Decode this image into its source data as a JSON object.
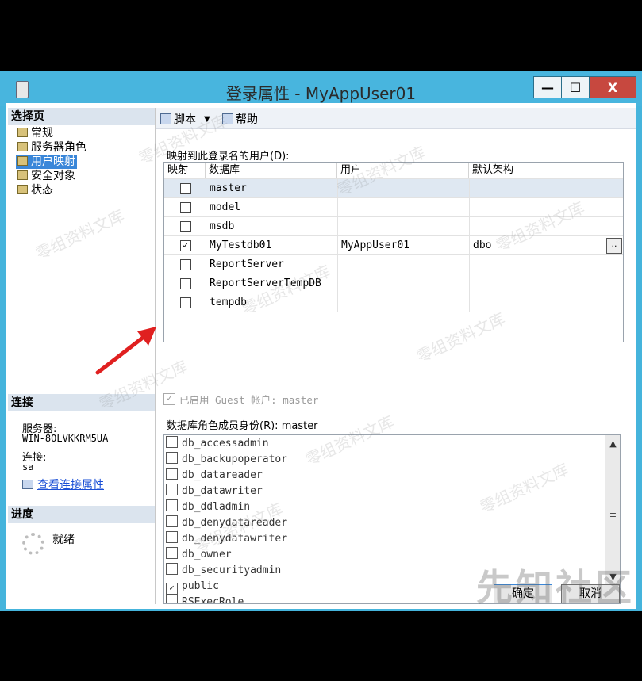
{
  "window": {
    "title": "登录属性 - MyAppUser01",
    "controls": {
      "minimize": "—",
      "maximize": "☐",
      "close": "X"
    }
  },
  "left": {
    "select_page_header": "选择页",
    "pages": [
      {
        "label": "常规",
        "selected": false
      },
      {
        "label": "服务器角色",
        "selected": false
      },
      {
        "label": "用户映射",
        "selected": true
      },
      {
        "label": "安全对象",
        "selected": false
      },
      {
        "label": "状态",
        "selected": false
      }
    ],
    "connection_header": "连接",
    "server_label": "服务器:",
    "server_value": "WIN-8OLVKKRM5UA",
    "conn_label": "连接:",
    "conn_value": "sa",
    "view_conn_link": "查看连接属性",
    "progress_header": "进度",
    "progress_status": "就绪"
  },
  "toolbar": {
    "script": "脚本",
    "help": "帮助"
  },
  "mapping": {
    "label": "映射到此登录名的用户(D):",
    "columns": [
      "映射",
      "数据库",
      "用户",
      "默认架构"
    ],
    "rows": [
      {
        "checked": false,
        "db": "master",
        "user": "",
        "schema": ""
      },
      {
        "checked": false,
        "db": "model",
        "user": "",
        "schema": ""
      },
      {
        "checked": false,
        "db": "msdb",
        "user": "",
        "schema": ""
      },
      {
        "checked": true,
        "db": "MyTestdb01",
        "user": "MyAppUser01",
        "schema": "dbo"
      },
      {
        "checked": false,
        "db": "ReportServer",
        "user": "",
        "schema": ""
      },
      {
        "checked": false,
        "db": "ReportServerTempDB",
        "user": "",
        "schema": ""
      },
      {
        "checked": false,
        "db": "tempdb",
        "user": "",
        "schema": ""
      }
    ],
    "ellipsis": ".."
  },
  "guest": {
    "label": "已启用 Guest 帐户: master",
    "checked": true
  },
  "roles": {
    "label": "数据库角色成员身份(R): master",
    "items": [
      {
        "name": "db_accessadmin",
        "checked": false
      },
      {
        "name": "db_backupoperator",
        "checked": false
      },
      {
        "name": "db_datareader",
        "checked": false
      },
      {
        "name": "db_datawriter",
        "checked": false
      },
      {
        "name": "db_ddladmin",
        "checked": false
      },
      {
        "name": "db_denydatareader",
        "checked": false
      },
      {
        "name": "db_denydatawriter",
        "checked": false
      },
      {
        "name": "db_owner",
        "checked": false
      },
      {
        "name": "db_securityadmin",
        "checked": false
      },
      {
        "name": "public",
        "checked": true
      },
      {
        "name": "RSExecRole",
        "checked": false
      }
    ]
  },
  "buttons": {
    "ok": "确定",
    "cancel": "取消"
  },
  "watermarks": {
    "repeat": "零组资料文库",
    "brand": "先知社区"
  },
  "colors": {
    "title_bar": "#48b5de",
    "selected": "#3a87d9",
    "arrow": "#e02020"
  }
}
